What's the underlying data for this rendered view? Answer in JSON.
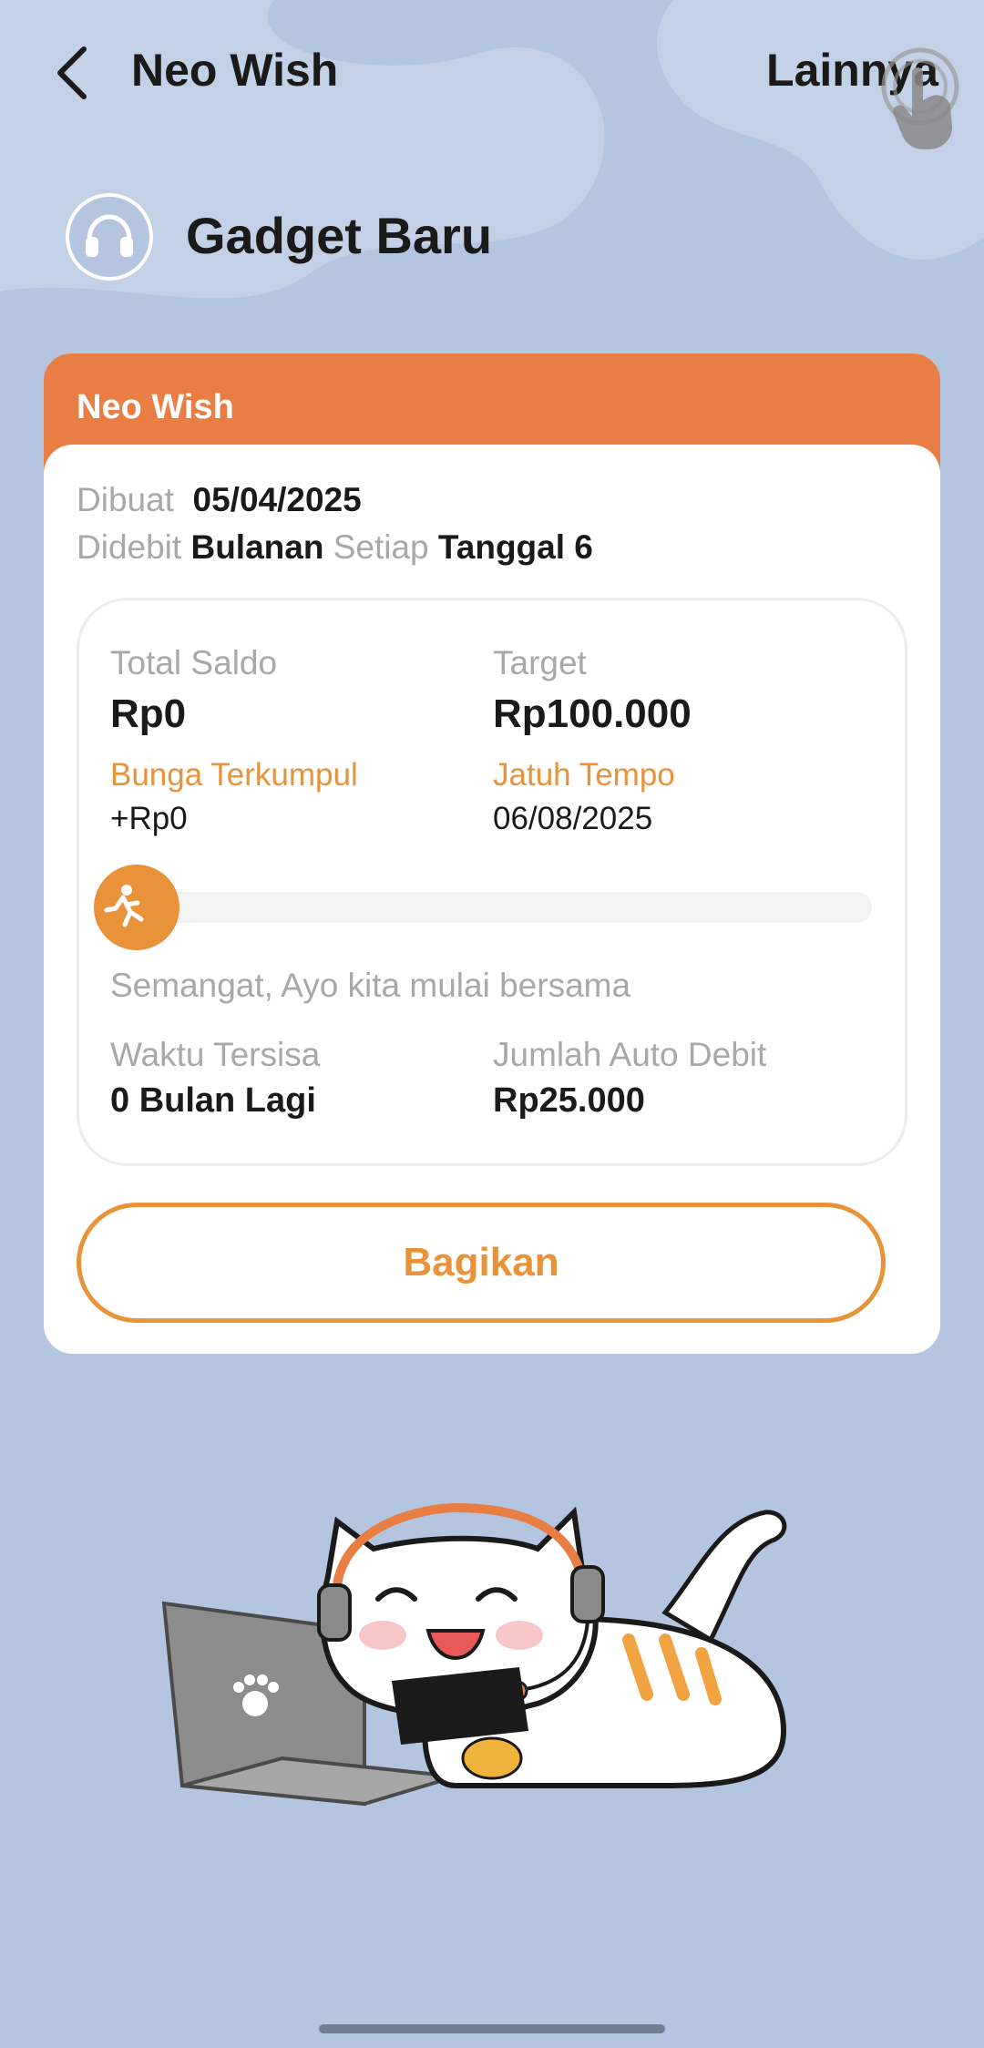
{
  "header": {
    "title": "Neo Wish",
    "more_label": "Lainnya"
  },
  "goal": {
    "title": "Gadget Baru",
    "icon": "headphones-icon"
  },
  "card": {
    "header_label": "Neo Wish",
    "created_label": "Dibuat",
    "created_value": "05/04/2025",
    "debited_label": "Didebit",
    "debited_value": "Bulanan",
    "every_label": "Setiap",
    "every_value": "Tanggal 6",
    "total_balance_label": "Total Saldo",
    "total_balance_value": "Rp0",
    "target_label": "Target",
    "target_value": "Rp100.000",
    "interest_label": "Bunga Terkumpul",
    "interest_value": "+Rp0",
    "due_label": "Jatuh Tempo",
    "due_value": "06/08/2025",
    "progress_fraction": 0.0,
    "motivation_text": "Semangat, Ayo kita mulai bersama",
    "time_left_label": "Waktu Tersisa",
    "time_left_value": "0 Bulan Lagi",
    "auto_debit_label": "Jumlah Auto Debit",
    "auto_debit_value": "Rp25.000",
    "share_label": "Bagikan"
  },
  "colors": {
    "background": "#b4c5df",
    "accent_orange": "#e97e44",
    "accent_text": "#e8933a",
    "card": "#ffffff"
  },
  "icons": [
    "back-arrow-icon",
    "tap-hand-icon",
    "headphones-icon",
    "runner-icon",
    "paw-icon"
  ]
}
